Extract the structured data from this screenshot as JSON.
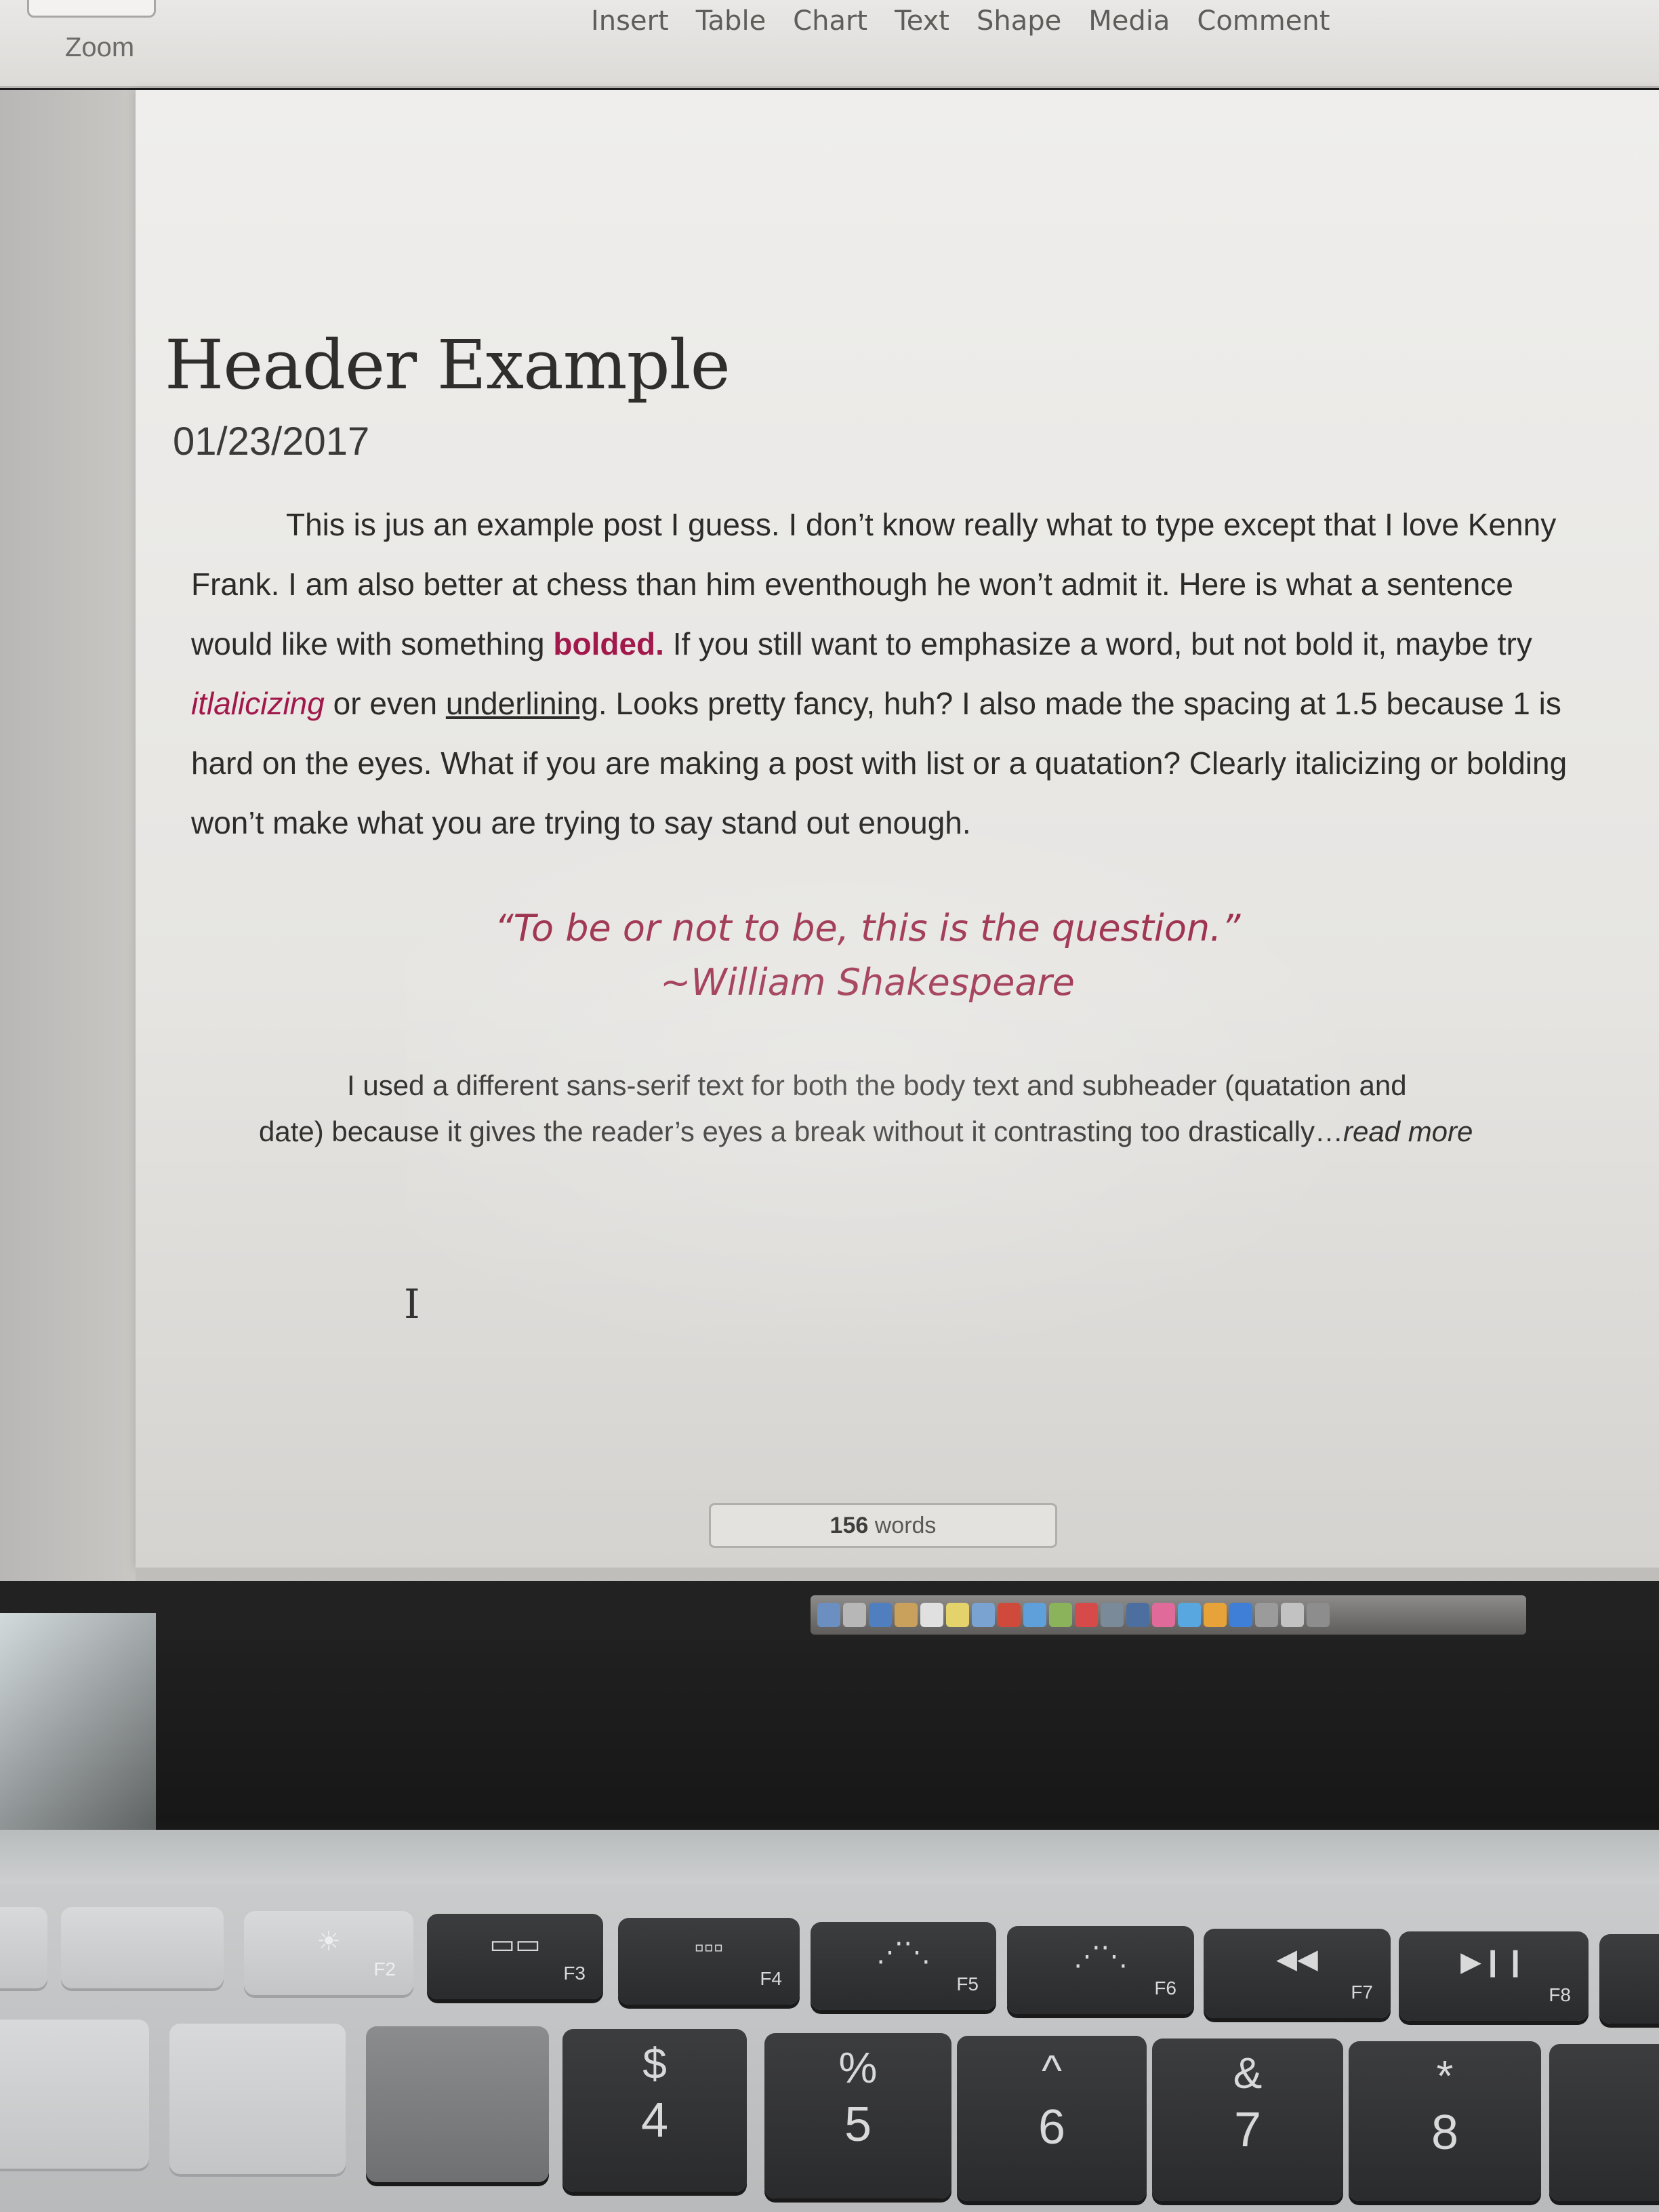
{
  "toolbar": {
    "zoom_label": "Zoom",
    "menu": [
      "Insert",
      "Table",
      "Chart",
      "Text",
      "Shape",
      "Media",
      "Comment"
    ]
  },
  "document": {
    "title": "Header Example",
    "date": "01/23/2017",
    "para1": {
      "a": "This is jus an example post I guess. I don’t know really what to type except that I love Kenny Frank. I am also better at chess than him eventhough he won’t admit it. Here is what a sentence would like with something ",
      "bold": "bolded.",
      "b": " If you still want to emphasize a word, but not bold it, maybe try ",
      "italic": "itlalicizing",
      "c": " or even ",
      "underline": "underlining",
      "d": ". Looks pretty fancy, huh? I also made the spacing at 1.5 because 1 is hard on the eyes. What if you are making a post with list or a quatation? Clearly italicizing or bolding won’t make what you are trying to say stand out enough."
    },
    "quote_line": "“To be or not to be, this is the question.”",
    "quote_author": "~William Shakespeare",
    "para2": {
      "text": "I used a different sans-serif text for both the body text and subheader (quatation and date) because it gives the reader’s eyes a break without it contrasting too drastically…",
      "read_more": "read more"
    }
  },
  "wordcount": {
    "number": "156",
    "unit": "words"
  },
  "keyboard": {
    "fkeys": [
      "F2",
      "F3",
      "F4",
      "F5",
      "F6",
      "F7",
      "F8"
    ],
    "number_keys": [
      {
        "top": "$",
        "bottom": "4"
      },
      {
        "top": "%",
        "bottom": "5"
      },
      {
        "top": "^",
        "bottom": "6"
      },
      {
        "top": "&",
        "bottom": "7"
      },
      {
        "top": "*",
        "bottom": "8"
      }
    ]
  },
  "colors": {
    "accent": "#a2184b",
    "quote": "#9b2d4a"
  }
}
